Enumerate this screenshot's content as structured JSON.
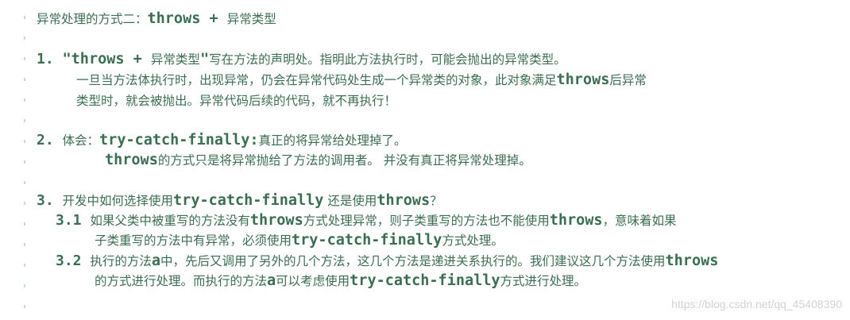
{
  "document": {
    "heading_text": "异常处理的方式二：",
    "heading_code": "throws + ",
    "heading_tail": "异常类型",
    "point1": {
      "number": "1.",
      "code_open": "\"throws + ",
      "cn_type": "异常类型",
      "code_close": "\"",
      "text": "写在方法的声明处。指明此方法执行时，可能会抛出的异常类型。",
      "line2_a": "一旦当方法体执行时，出现异常，仍会在异常代码处生成一个异常类的对象，此对象满足",
      "line2_code": "throws",
      "line2_b": "后异常",
      "line3": "类型时，就会被抛出。异常代码后续的代码，就不再执行！"
    },
    "point2": {
      "number": "2.",
      "label": "体会：",
      "code": "try-catch-finally:",
      "text": "真正的将异常给处理掉了。",
      "line2_code": "throws",
      "line2_text": "的方式只是将异常抛给了方法的调用者。 并没有真正将异常处理掉。"
    },
    "point3": {
      "number": "3.",
      "text_a": "开发中如何选择使用",
      "code_a": "try-catch-finally",
      "text_b": " 还是使用",
      "code_b": "throws",
      "text_c": "？",
      "sub1": {
        "number": "3.1",
        "text_a": "如果父类中被重写的方法没有",
        "code_a": "throws",
        "text_b": "方式处理异常，则子类重写的方法也不能使用",
        "code_b": "throws",
        "text_c": "，意味着如果",
        "line2_a": "子类重写的方法中有异常，必须使用",
        "line2_code": "try-catch-finally",
        "line2_b": "方式处理。"
      },
      "sub2": {
        "number": "3.2",
        "text_a": "执行的方法",
        "code_a": "a",
        "text_b": "中，先后又调用了另外的几个方法，这几个方法是递进关系执行的。我们建议这几个方法使用",
        "code_b": "throws",
        "line2_a": "的方式进行处理。而执行的方法",
        "line2_code_a": "a",
        "line2_b": "可以考虑使用",
        "line2_code_b": "try-catch-finally",
        "line2_c": "方式进行处理。"
      }
    }
  },
  "watermark": "https://blog.csdn.net/qq_45408390",
  "colors": {
    "text": "#3b6e53",
    "gutter": "#c8d8cf",
    "watermark": "#d2d2d2"
  }
}
